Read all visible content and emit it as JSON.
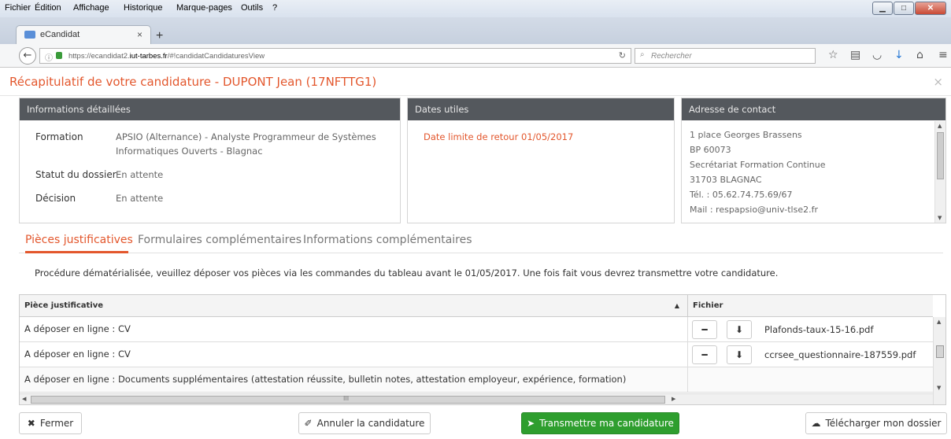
{
  "menubar": {
    "items": [
      "Fichier",
      "Édition",
      "Affichage",
      "Historique",
      "Marque-pages",
      "Outils",
      "?"
    ]
  },
  "browser": {
    "tab_title": "eCandidat",
    "url_prefix": "https://ecandidat2.",
    "url_domain": "iut-tarbes.fr",
    "url_path": "/#!candidatCandidaturesView",
    "search_placeholder": "Rechercher"
  },
  "modal": {
    "title": "Récapitulatif de votre candidature - DUPONT Jean (17NFTTG1)",
    "close": "×"
  },
  "details": {
    "header": "Informations détaillées",
    "formation_label": "Formation",
    "formation_value_line1": "APSIO (Alternance) - Analyste Programmeur de Systèmes",
    "formation_value_line2": "Informatiques Ouverts - Blagnac",
    "statut_label": "Statut du dossier",
    "statut_value": "En attente",
    "decision_label": "Décision",
    "decision_value": "En attente"
  },
  "dates": {
    "header": "Dates utiles",
    "label": "Date limite de retour",
    "value": "01/05/2017"
  },
  "contact": {
    "header": "Adresse de contact",
    "lines": [
      "1 place Georges Brassens",
      "BP 60073",
      "Secrétariat Formation Continue",
      "31703 BLAGNAC",
      "Tél. : 05.62.74.75.69/67",
      "Mail : respapsio@univ-tlse2.fr"
    ]
  },
  "tabs": [
    "Pièces justificatives",
    "Formulaires complémentaires",
    "Informations complémentaires"
  ],
  "instructions": "Procédure dématérialisée, veuillez déposer vos pièces via les commandes du tableau avant le 01/05/2017. Une fois fait vous devrez transmettre votre candidature.",
  "grid": {
    "headers": [
      "Pièce justificative",
      "Fichier"
    ],
    "rows": [
      {
        "piece": "A déposer en ligne : CV",
        "file": "Plafonds-taux-15-16.pdf"
      },
      {
        "piece": "A déposer en ligne : CV",
        "file": "ccrsee_questionnaire-187559.pdf"
      },
      {
        "piece": "A déposer en ligne : Documents supplémentaires (attestation réussite, bulletin notes, attestation employeur, expérience, formation)",
        "file": ""
      }
    ],
    "hscroll_mark": "III"
  },
  "footer": {
    "close": "Fermer",
    "cancel": "Annuler la candidature",
    "submit": "Transmettre ma candidature",
    "download": "Télécharger mon dossier"
  },
  "colors": {
    "accent": "#e3572d",
    "panel_header": "#54585d",
    "primary": "#2e9e2e"
  }
}
